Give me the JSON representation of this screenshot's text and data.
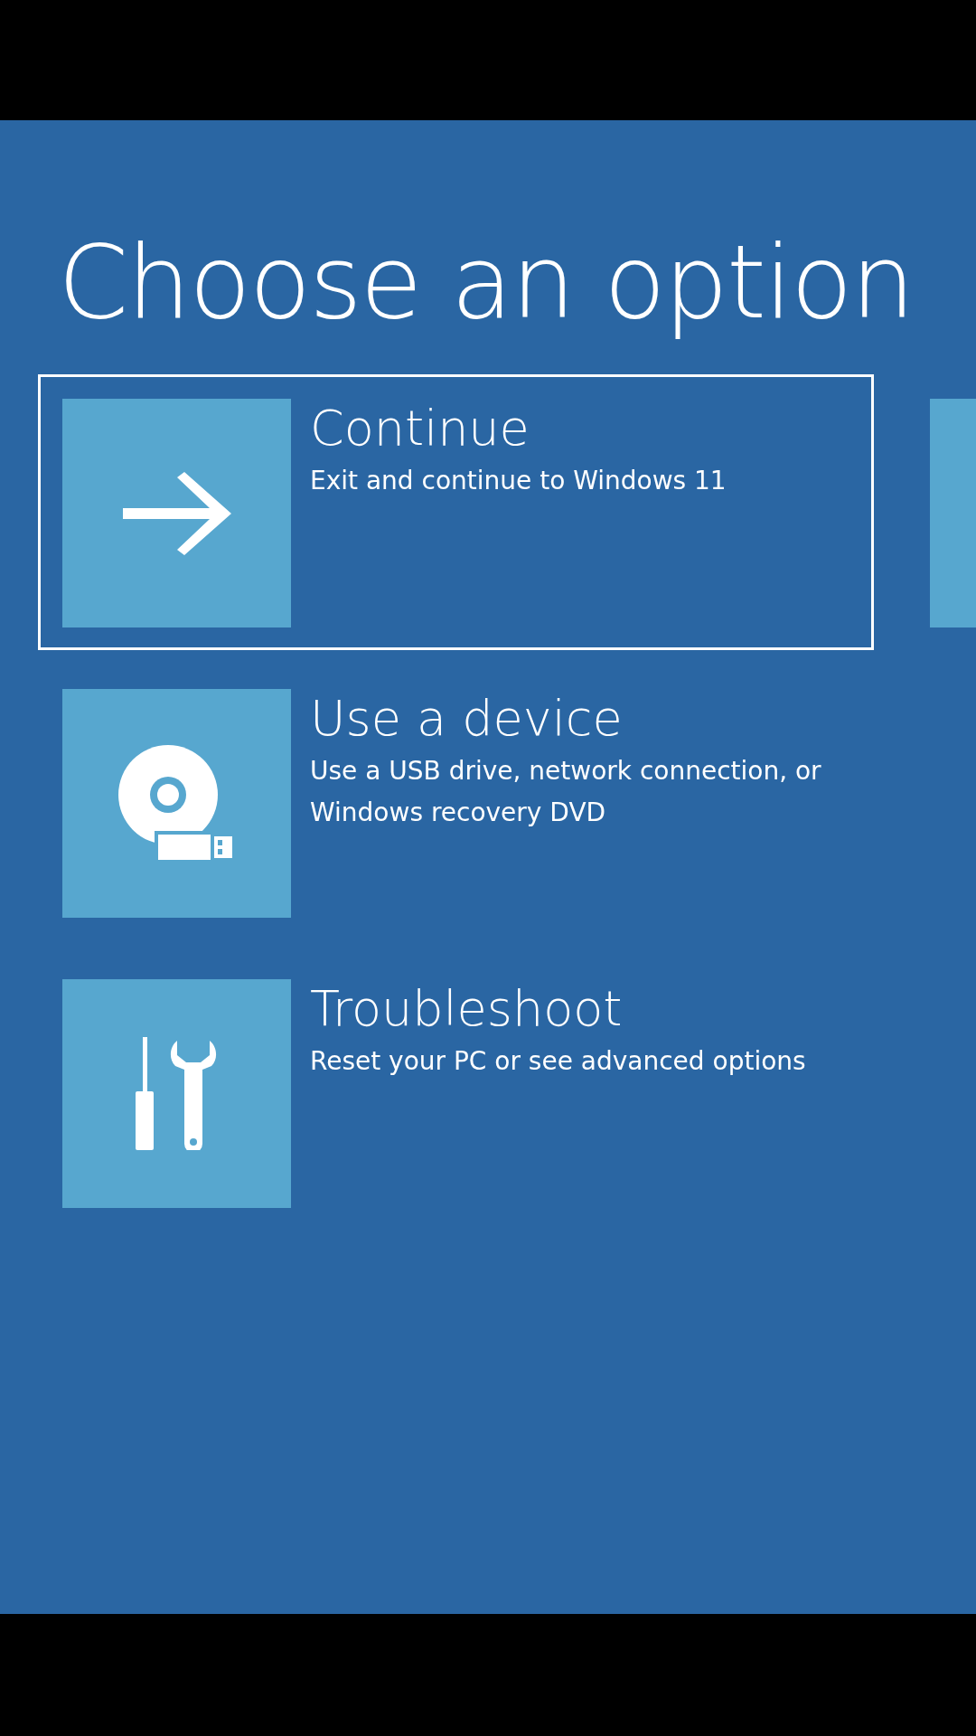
{
  "title": "Choose an option",
  "options": [
    {
      "kind": "continue",
      "label": "Continue",
      "description": "Exit and continue to Windows 11",
      "selected": true
    },
    {
      "kind": "device",
      "label": "Use a device",
      "description": "Use a USB drive, network connection, or Windows recovery DVD",
      "selected": false
    },
    {
      "kind": "troubleshoot",
      "label": "Troubleshoot",
      "description": "Reset your PC or see advanced options",
      "selected": false
    }
  ]
}
